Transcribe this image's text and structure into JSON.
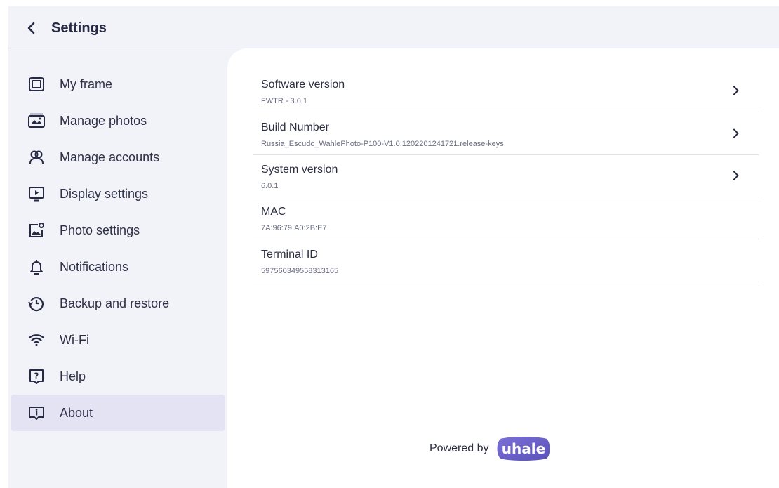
{
  "header": {
    "title": "Settings"
  },
  "sidebar": {
    "items": [
      {
        "label": "My frame",
        "icon": "frame-icon"
      },
      {
        "label": "Manage photos",
        "icon": "photos-icon"
      },
      {
        "label": "Manage accounts",
        "icon": "accounts-icon"
      },
      {
        "label": "Display settings",
        "icon": "display-icon"
      },
      {
        "label": "Photo settings",
        "icon": "photo-settings-icon"
      },
      {
        "label": "Notifications",
        "icon": "bell-icon"
      },
      {
        "label": "Backup and restore",
        "icon": "history-icon"
      },
      {
        "label": "Wi-Fi",
        "icon": "wifi-icon"
      },
      {
        "label": "Help",
        "icon": "help-icon"
      },
      {
        "label": "About",
        "icon": "info-icon",
        "active": true
      }
    ]
  },
  "about": {
    "rows": [
      {
        "title": "Software version",
        "value": "FWTR - 3.6.1",
        "chevron": true
      },
      {
        "title": "Build Number",
        "value": "Russia_Escudo_WahlePhoto-P100-V1.0.1202201241721.release-keys",
        "chevron": true
      },
      {
        "title": "System version",
        "value": "6.0.1",
        "chevron": true
      },
      {
        "title": "MAC",
        "value": "7A:96:79:A0:2B:E7",
        "chevron": false
      },
      {
        "title": "Terminal ID",
        "value": "597560349558313165",
        "chevron": false
      }
    ]
  },
  "footer": {
    "powered_by": "Powered by",
    "logo_text": "uhale"
  },
  "colors": {
    "accent": "#6b63c9",
    "active_bg": "#e3e3f4",
    "app_bg": "#f2f3f8",
    "content_bg": "#ffffff",
    "text": "#2b2d42"
  }
}
